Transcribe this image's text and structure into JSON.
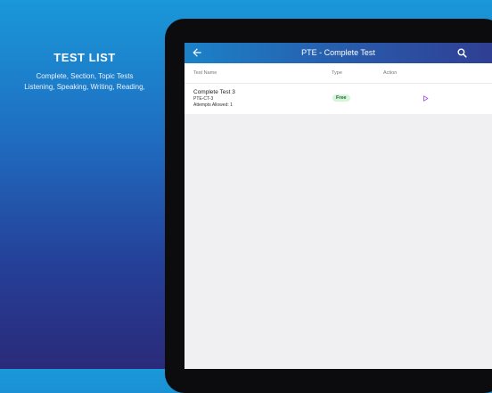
{
  "promo": {
    "title": "TEST LIST",
    "line1": "Complete, Section, Topic Tests",
    "line2": "Listening, Speaking, Writing, Reading,"
  },
  "appbar": {
    "title": "PTE - Complete Test"
  },
  "table": {
    "headers": [
      "Test Name",
      "Type",
      "Action"
    ],
    "rows": [
      {
        "name": "Complete Test 3",
        "code": "PTE-CT-3",
        "attempts": "Attempts Allowed: 1",
        "type": "Free"
      }
    ]
  },
  "colors": {
    "accent": "#2a56a8",
    "badge_bg": "#d8f3dc",
    "play": "#a050e8"
  },
  "icons": {
    "back": "arrow-left-icon",
    "search": "search-icon",
    "action": "play-icon"
  }
}
